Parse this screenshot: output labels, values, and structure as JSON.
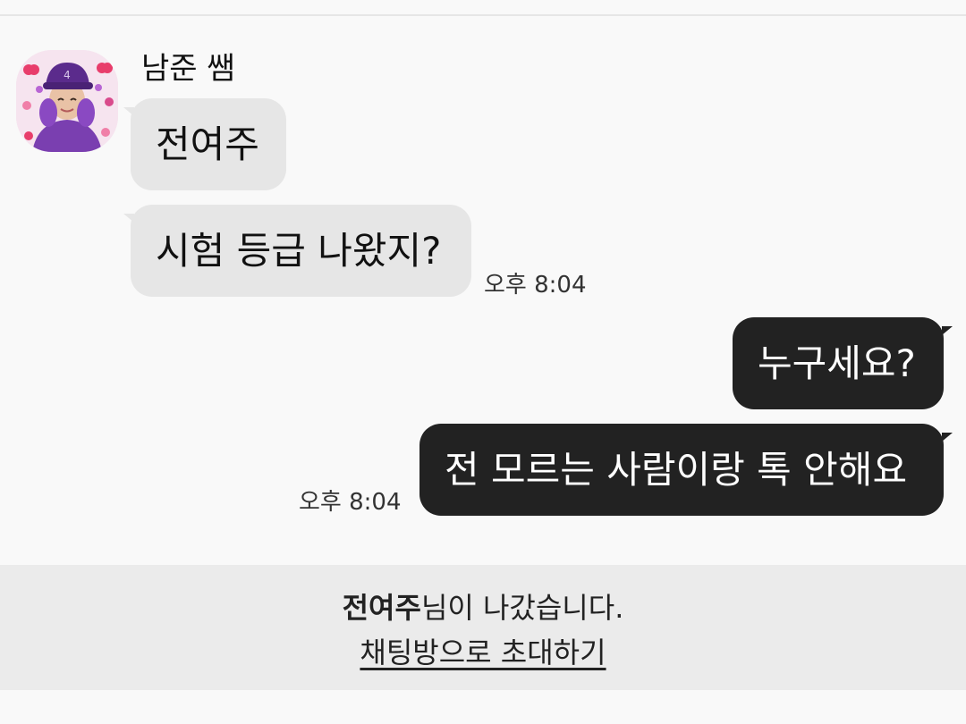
{
  "chat": {
    "sender_name": "남준 쌤",
    "messages_in": [
      {
        "text": "전여주"
      },
      {
        "text": "시험 등급 나왔지?",
        "time": "오후 8:04"
      }
    ],
    "messages_out": [
      {
        "text": "누구세요?"
      },
      {
        "text": "전 모르는 사람이랑 톡 안해요",
        "time": "오후 8:04"
      }
    ]
  },
  "notice": {
    "name": "전여주",
    "left_text": "님이 나갔습니다.",
    "invite_link": "채팅방으로 초대하기"
  },
  "colors": {
    "background": "#f9f9f9",
    "incoming_bubble": "#e6e6e6",
    "outgoing_bubble": "#222222",
    "notice_bar": "#ebebeb"
  },
  "icons": {
    "avatar": "profile-photo-avatar"
  }
}
